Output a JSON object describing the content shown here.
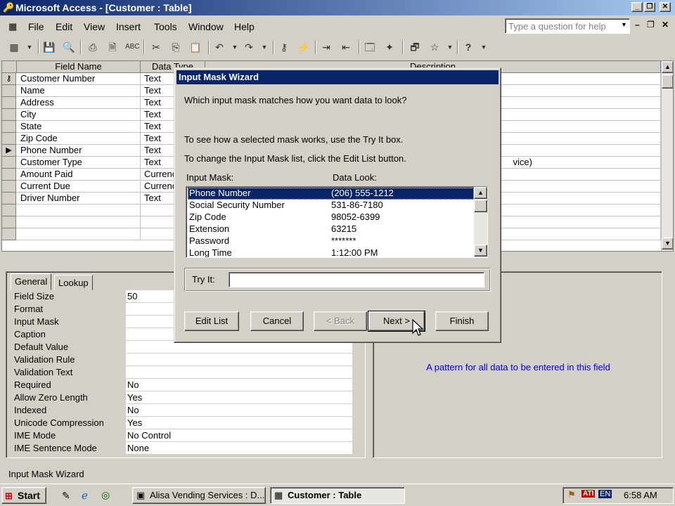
{
  "app": {
    "title": "Microsoft Access - [Customer : Table]",
    "help_placeholder": "Type a question for help"
  },
  "menu": [
    "File",
    "Edit",
    "View",
    "Insert",
    "Tools",
    "Window",
    "Help"
  ],
  "grid": {
    "headers": [
      "Field Name",
      "Data Type",
      "Description"
    ],
    "rows": [
      {
        "name": "Customer Number",
        "type": "Text",
        "desc": ""
      },
      {
        "name": "Name",
        "type": "Text",
        "desc": ""
      },
      {
        "name": "Address",
        "type": "Text",
        "desc": ""
      },
      {
        "name": "City",
        "type": "Text",
        "desc": ""
      },
      {
        "name": "State",
        "type": "Text",
        "desc": ""
      },
      {
        "name": "Zip Code",
        "type": "Text",
        "desc": ""
      },
      {
        "name": "Phone Number",
        "type": "Text",
        "desc": ""
      },
      {
        "name": "Customer Type",
        "type": "Text",
        "desc": "vice)"
      },
      {
        "name": "Amount Paid",
        "type": "Currenc",
        "desc": ""
      },
      {
        "name": "Current Due",
        "type": "Currenc",
        "desc": ""
      },
      {
        "name": "Driver Number",
        "type": "Text",
        "desc": ""
      }
    ]
  },
  "props": {
    "tabs": [
      "General",
      "Lookup"
    ],
    "rows": [
      {
        "label": "Field Size",
        "value": "50"
      },
      {
        "label": "Format",
        "value": ""
      },
      {
        "label": "Input Mask",
        "value": ""
      },
      {
        "label": "Caption",
        "value": ""
      },
      {
        "label": "Default Value",
        "value": ""
      },
      {
        "label": "Validation Rule",
        "value": ""
      },
      {
        "label": "Validation Text",
        "value": ""
      },
      {
        "label": "Required",
        "value": "No"
      },
      {
        "label": "Allow Zero Length",
        "value": "Yes"
      },
      {
        "label": "Indexed",
        "value": "No"
      },
      {
        "label": "Unicode Compression",
        "value": "Yes"
      },
      {
        "label": "IME Mode",
        "value": "No Control"
      },
      {
        "label": "IME Sentence Mode",
        "value": "None"
      }
    ],
    "hint": "A pattern for all data to be entered in this field"
  },
  "dialog": {
    "title": "Input Mask Wizard",
    "question": "Which input mask matches how you want data to look?",
    "tip1": "To see how a selected mask works, use the Try It box.",
    "tip2": "To change the Input Mask list, click the Edit List button.",
    "col_mask": "Input Mask:",
    "col_look": "Data Look:",
    "masks": [
      {
        "mask": "Phone Number",
        "look": "(206) 555-1212"
      },
      {
        "mask": "Social Security Number",
        "look": "531-86-7180"
      },
      {
        "mask": "Zip Code",
        "look": "98052-6399"
      },
      {
        "mask": "Extension",
        "look": "63215"
      },
      {
        "mask": "Password",
        "look": "*******"
      },
      {
        "mask": "Long Time",
        "look": "1:12:00 PM"
      }
    ],
    "try_label": "Try It:",
    "try_value": "",
    "buttons": {
      "edit": "Edit List",
      "cancel": "Cancel",
      "back": "< Back",
      "next": "Next >",
      "finish": "Finish"
    }
  },
  "status": "Input Mask Wizard",
  "taskbar": {
    "start": "Start",
    "tasks": [
      "Alisa Vending Services : D...",
      "Customer : Table"
    ],
    "clock": "6:58 AM",
    "lang": "EN"
  }
}
